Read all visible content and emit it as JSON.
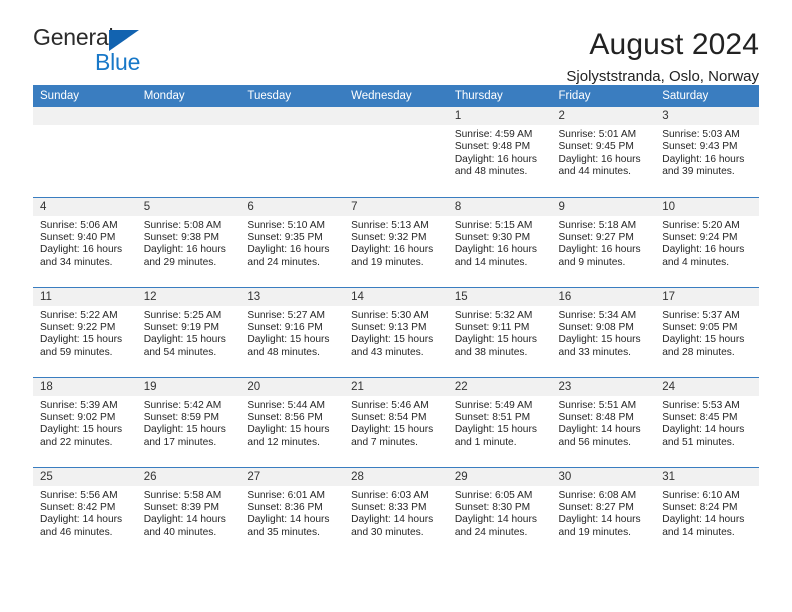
{
  "brand": {
    "name_top": "General",
    "name_bottom": "Blue",
    "accent_color": "#1878c8"
  },
  "header": {
    "title": "August 2024",
    "subtitle": "Sjolyststranda, Oslo, Norway"
  },
  "calendar": {
    "header_bg": "#3a7dc0",
    "daynum_bg": "#f1f1f1",
    "weekday_names": [
      "Sunday",
      "Monday",
      "Tuesday",
      "Wednesday",
      "Thursday",
      "Friday",
      "Saturday"
    ],
    "weeks": [
      [
        {
          "day": "",
          "blank": true
        },
        {
          "day": "",
          "blank": true
        },
        {
          "day": "",
          "blank": true
        },
        {
          "day": "",
          "blank": true
        },
        {
          "day": "1",
          "sunrise": "Sunrise: 4:59 AM",
          "sunset": "Sunset: 9:48 PM",
          "daylight_1": "Daylight: 16 hours",
          "daylight_2": "and 48 minutes."
        },
        {
          "day": "2",
          "sunrise": "Sunrise: 5:01 AM",
          "sunset": "Sunset: 9:45 PM",
          "daylight_1": "Daylight: 16 hours",
          "daylight_2": "and 44 minutes."
        },
        {
          "day": "3",
          "sunrise": "Sunrise: 5:03 AM",
          "sunset": "Sunset: 9:43 PM",
          "daylight_1": "Daylight: 16 hours",
          "daylight_2": "and 39 minutes."
        }
      ],
      [
        {
          "day": "4",
          "sunrise": "Sunrise: 5:06 AM",
          "sunset": "Sunset: 9:40 PM",
          "daylight_1": "Daylight: 16 hours",
          "daylight_2": "and 34 minutes."
        },
        {
          "day": "5",
          "sunrise": "Sunrise: 5:08 AM",
          "sunset": "Sunset: 9:38 PM",
          "daylight_1": "Daylight: 16 hours",
          "daylight_2": "and 29 minutes."
        },
        {
          "day": "6",
          "sunrise": "Sunrise: 5:10 AM",
          "sunset": "Sunset: 9:35 PM",
          "daylight_1": "Daylight: 16 hours",
          "daylight_2": "and 24 minutes."
        },
        {
          "day": "7",
          "sunrise": "Sunrise: 5:13 AM",
          "sunset": "Sunset: 9:32 PM",
          "daylight_1": "Daylight: 16 hours",
          "daylight_2": "and 19 minutes."
        },
        {
          "day": "8",
          "sunrise": "Sunrise: 5:15 AM",
          "sunset": "Sunset: 9:30 PM",
          "daylight_1": "Daylight: 16 hours",
          "daylight_2": "and 14 minutes."
        },
        {
          "day": "9",
          "sunrise": "Sunrise: 5:18 AM",
          "sunset": "Sunset: 9:27 PM",
          "daylight_1": "Daylight: 16 hours",
          "daylight_2": "and 9 minutes."
        },
        {
          "day": "10",
          "sunrise": "Sunrise: 5:20 AM",
          "sunset": "Sunset: 9:24 PM",
          "daylight_1": "Daylight: 16 hours",
          "daylight_2": "and 4 minutes."
        }
      ],
      [
        {
          "day": "11",
          "sunrise": "Sunrise: 5:22 AM",
          "sunset": "Sunset: 9:22 PM",
          "daylight_1": "Daylight: 15 hours",
          "daylight_2": "and 59 minutes."
        },
        {
          "day": "12",
          "sunrise": "Sunrise: 5:25 AM",
          "sunset": "Sunset: 9:19 PM",
          "daylight_1": "Daylight: 15 hours",
          "daylight_2": "and 54 minutes."
        },
        {
          "day": "13",
          "sunrise": "Sunrise: 5:27 AM",
          "sunset": "Sunset: 9:16 PM",
          "daylight_1": "Daylight: 15 hours",
          "daylight_2": "and 48 minutes."
        },
        {
          "day": "14",
          "sunrise": "Sunrise: 5:30 AM",
          "sunset": "Sunset: 9:13 PM",
          "daylight_1": "Daylight: 15 hours",
          "daylight_2": "and 43 minutes."
        },
        {
          "day": "15",
          "sunrise": "Sunrise: 5:32 AM",
          "sunset": "Sunset: 9:11 PM",
          "daylight_1": "Daylight: 15 hours",
          "daylight_2": "and 38 minutes."
        },
        {
          "day": "16",
          "sunrise": "Sunrise: 5:34 AM",
          "sunset": "Sunset: 9:08 PM",
          "daylight_1": "Daylight: 15 hours",
          "daylight_2": "and 33 minutes."
        },
        {
          "day": "17",
          "sunrise": "Sunrise: 5:37 AM",
          "sunset": "Sunset: 9:05 PM",
          "daylight_1": "Daylight: 15 hours",
          "daylight_2": "and 28 minutes."
        }
      ],
      [
        {
          "day": "18",
          "sunrise": "Sunrise: 5:39 AM",
          "sunset": "Sunset: 9:02 PM",
          "daylight_1": "Daylight: 15 hours",
          "daylight_2": "and 22 minutes."
        },
        {
          "day": "19",
          "sunrise": "Sunrise: 5:42 AM",
          "sunset": "Sunset: 8:59 PM",
          "daylight_1": "Daylight: 15 hours",
          "daylight_2": "and 17 minutes."
        },
        {
          "day": "20",
          "sunrise": "Sunrise: 5:44 AM",
          "sunset": "Sunset: 8:56 PM",
          "daylight_1": "Daylight: 15 hours",
          "daylight_2": "and 12 minutes."
        },
        {
          "day": "21",
          "sunrise": "Sunrise: 5:46 AM",
          "sunset": "Sunset: 8:54 PM",
          "daylight_1": "Daylight: 15 hours",
          "daylight_2": "and 7 minutes."
        },
        {
          "day": "22",
          "sunrise": "Sunrise: 5:49 AM",
          "sunset": "Sunset: 8:51 PM",
          "daylight_1": "Daylight: 15 hours",
          "daylight_2": "and 1 minute."
        },
        {
          "day": "23",
          "sunrise": "Sunrise: 5:51 AM",
          "sunset": "Sunset: 8:48 PM",
          "daylight_1": "Daylight: 14 hours",
          "daylight_2": "and 56 minutes."
        },
        {
          "day": "24",
          "sunrise": "Sunrise: 5:53 AM",
          "sunset": "Sunset: 8:45 PM",
          "daylight_1": "Daylight: 14 hours",
          "daylight_2": "and 51 minutes."
        }
      ],
      [
        {
          "day": "25",
          "sunrise": "Sunrise: 5:56 AM",
          "sunset": "Sunset: 8:42 PM",
          "daylight_1": "Daylight: 14 hours",
          "daylight_2": "and 46 minutes."
        },
        {
          "day": "26",
          "sunrise": "Sunrise: 5:58 AM",
          "sunset": "Sunset: 8:39 PM",
          "daylight_1": "Daylight: 14 hours",
          "daylight_2": "and 40 minutes."
        },
        {
          "day": "27",
          "sunrise": "Sunrise: 6:01 AM",
          "sunset": "Sunset: 8:36 PM",
          "daylight_1": "Daylight: 14 hours",
          "daylight_2": "and 35 minutes."
        },
        {
          "day": "28",
          "sunrise": "Sunrise: 6:03 AM",
          "sunset": "Sunset: 8:33 PM",
          "daylight_1": "Daylight: 14 hours",
          "daylight_2": "and 30 minutes."
        },
        {
          "day": "29",
          "sunrise": "Sunrise: 6:05 AM",
          "sunset": "Sunset: 8:30 PM",
          "daylight_1": "Daylight: 14 hours",
          "daylight_2": "and 24 minutes."
        },
        {
          "day": "30",
          "sunrise": "Sunrise: 6:08 AM",
          "sunset": "Sunset: 8:27 PM",
          "daylight_1": "Daylight: 14 hours",
          "daylight_2": "and 19 minutes."
        },
        {
          "day": "31",
          "sunrise": "Sunrise: 6:10 AM",
          "sunset": "Sunset: 8:24 PM",
          "daylight_1": "Daylight: 14 hours",
          "daylight_2": "and 14 minutes."
        }
      ]
    ]
  }
}
